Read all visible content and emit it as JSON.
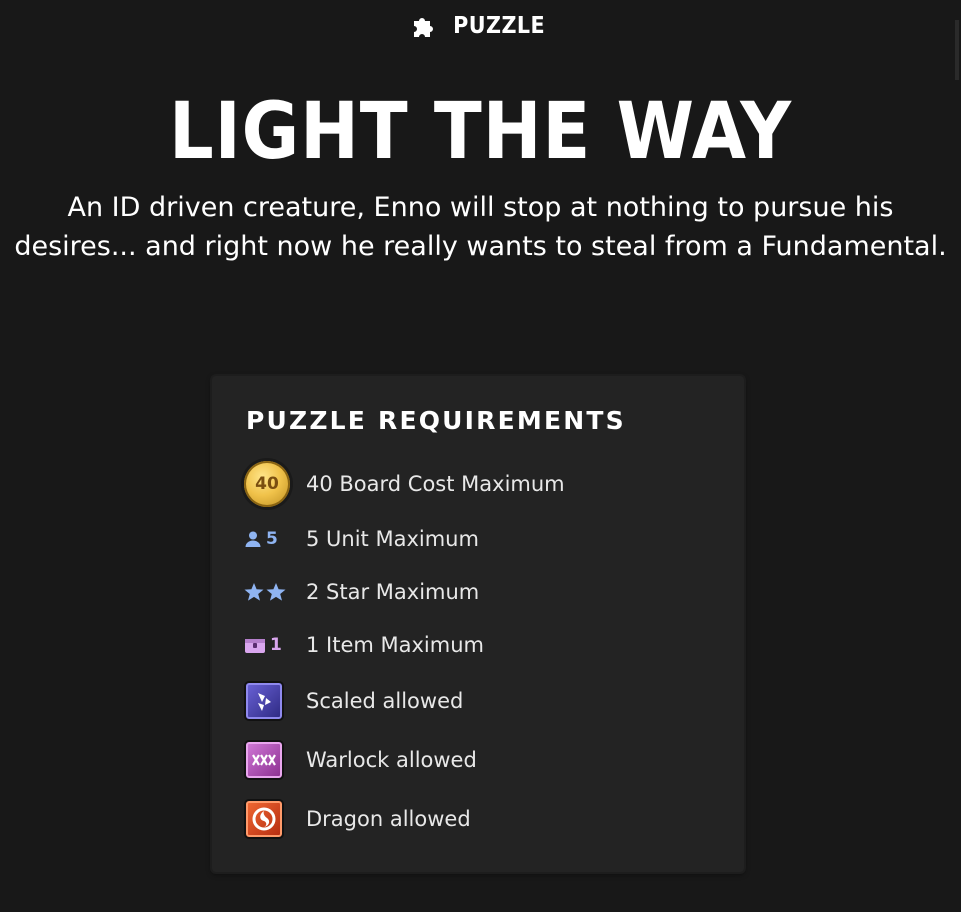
{
  "header": {
    "category_label": "PUZZLE",
    "category_icon": "puzzle-piece-icon"
  },
  "title": "LIGHT THE WAY",
  "description": "An ID driven creature, Enno will stop at nothing to pursue his desires... and right now he really wants to steal from a Fundamental.",
  "requirements": {
    "heading": "PUZZLE REQUIREMENTS",
    "items": [
      {
        "icon": "gold-coin-icon",
        "icon_text": "40",
        "label": "40 Board Cost Maximum",
        "color": "#f0c24a"
      },
      {
        "icon": "unit-person-icon",
        "icon_text": "5",
        "label": "5 Unit Maximum",
        "color": "#8fb4f2"
      },
      {
        "icon": "star-icon",
        "icon_text": "",
        "label": "2 Star Maximum",
        "color": "#8fb4f2",
        "stars": 2
      },
      {
        "icon": "item-chest-icon",
        "icon_text": "1",
        "label": "1 Item Maximum",
        "color": "#d9a6ee"
      },
      {
        "icon": "scaled-alliance-icon",
        "icon_text": "",
        "label": "Scaled allowed",
        "color": "#5a52c8"
      },
      {
        "icon": "warlock-alliance-icon",
        "icon_text": "",
        "label": "Warlock allowed",
        "color": "#b94fbf"
      },
      {
        "icon": "dragon-alliance-icon",
        "icon_text": "",
        "label": "Dragon allowed",
        "color": "#e2471c"
      }
    ]
  },
  "colors": {
    "background": "#181818",
    "panel": "#232323",
    "text": "#ffffff"
  }
}
